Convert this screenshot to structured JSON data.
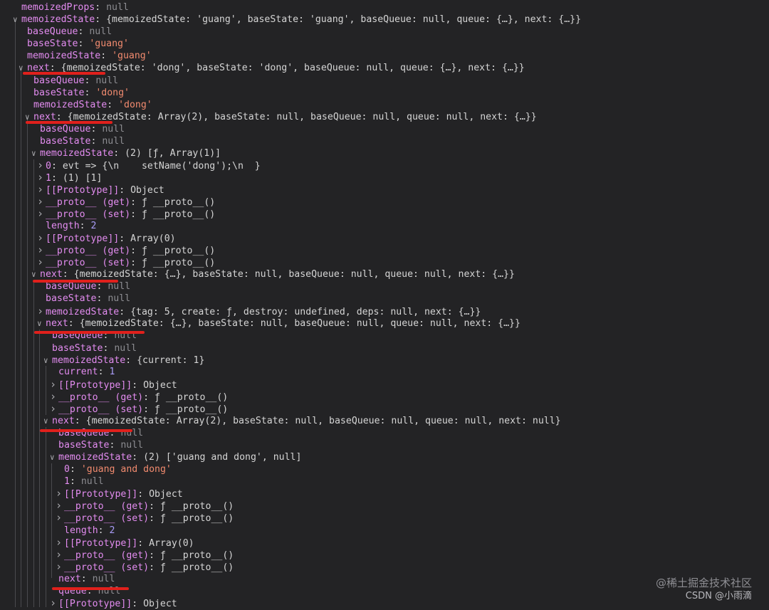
{
  "rows": [
    {
      "key": "memoizedProps",
      "val": "null",
      "t": "null",
      "arrow": ""
    },
    {
      "key": "memoizedState",
      "val": "{memoizedState: 'guang', baseState: 'guang', baseQueue: null, queue: {…}, next: {…}}",
      "t": "preview",
      "arrow": "down"
    },
    {
      "key": "baseQueue",
      "val": "null",
      "t": "null",
      "arrow": ""
    },
    {
      "key": "baseState",
      "val": "'guang'",
      "t": "string",
      "arrow": ""
    },
    {
      "key": "memoizedState",
      "val": "'guang'",
      "t": "string",
      "arrow": ""
    },
    {
      "key": "next",
      "val": "{memoizedState: 'dong', baseState: 'dong', baseQueue: null, queue: {…}, next: {…}}",
      "t": "preview",
      "arrow": "down"
    },
    {
      "key": "baseQueue",
      "val": "null",
      "t": "null",
      "arrow": ""
    },
    {
      "key": "baseState",
      "val": "'dong'",
      "t": "string",
      "arrow": ""
    },
    {
      "key": "memoizedState",
      "val": "'dong'",
      "t": "string",
      "arrow": ""
    },
    {
      "key": "next",
      "val": "{memoizedState: Array(2), baseState: null, baseQueue: null, queue: null, next: {…}}",
      "t": "preview",
      "arrow": "down"
    },
    {
      "key": "baseQueue",
      "val": "null",
      "t": "null",
      "arrow": ""
    },
    {
      "key": "baseState",
      "val": "null",
      "t": "null",
      "arrow": ""
    },
    {
      "key": "memoizedState",
      "val": "(2) [ƒ, Array(1)]",
      "t": "preview",
      "arrow": "down"
    },
    {
      "key": "0",
      "val": "evt => {\\n    setName('dong');\\n  }",
      "t": "func",
      "arrow": "right"
    },
    {
      "key": "1",
      "val": "(1) [1]",
      "t": "preview",
      "arrow": "right"
    },
    {
      "key": "[[Prototype]]",
      "val": "Object",
      "t": "preview",
      "arrow": "right"
    },
    {
      "key": "__proto__ (get)",
      "val": "ƒ __proto__()",
      "t": "func",
      "arrow": "right"
    },
    {
      "key": "__proto__ (set)",
      "val": "ƒ __proto__()",
      "t": "func",
      "arrow": "right"
    },
    {
      "key": "length",
      "val": "2",
      "t": "number",
      "arrow": ""
    },
    {
      "key": "[[Prototype]]",
      "val": "Array(0)",
      "t": "preview",
      "arrow": "right"
    },
    {
      "key": "__proto__ (get)",
      "val": "ƒ __proto__()",
      "t": "func",
      "arrow": "right"
    },
    {
      "key": "__proto__ (set)",
      "val": "ƒ __proto__()",
      "t": "func",
      "arrow": "right"
    },
    {
      "key": "next",
      "val": "{memoizedState: {…}, baseState: null, baseQueue: null, queue: null, next: {…}}",
      "t": "preview",
      "arrow": "down"
    },
    {
      "key": "baseQueue",
      "val": "null",
      "t": "null",
      "arrow": ""
    },
    {
      "key": "baseState",
      "val": "null",
      "t": "null",
      "arrow": ""
    },
    {
      "key": "memoizedState",
      "val": "{tag: 5, create: ƒ, destroy: undefined, deps: null, next: {…}}",
      "t": "preview",
      "arrow": "right"
    },
    {
      "key": "next",
      "val": "{memoizedState: {…}, baseState: null, baseQueue: null, queue: null, next: {…}}",
      "t": "preview",
      "arrow": "down"
    },
    {
      "key": "baseQueue",
      "val": "null",
      "t": "null",
      "arrow": ""
    },
    {
      "key": "baseState",
      "val": "null",
      "t": "null",
      "arrow": ""
    },
    {
      "key": "memoizedState",
      "val": "{current: 1}",
      "t": "preview",
      "arrow": "down"
    },
    {
      "key": "current",
      "val": "1",
      "t": "number",
      "arrow": ""
    },
    {
      "key": "[[Prototype]]",
      "val": "Object",
      "t": "preview",
      "arrow": "right"
    },
    {
      "key": "__proto__ (get)",
      "val": "ƒ __proto__()",
      "t": "func",
      "arrow": "right"
    },
    {
      "key": "__proto__ (set)",
      "val": "ƒ __proto__()",
      "t": "func",
      "arrow": "right"
    },
    {
      "key": "next",
      "val": "{memoizedState: Array(2), baseState: null, baseQueue: null, queue: null, next: null}",
      "t": "preview",
      "arrow": "down"
    },
    {
      "key": "baseQueue",
      "val": "null",
      "t": "null",
      "arrow": ""
    },
    {
      "key": "baseState",
      "val": "null",
      "t": "null",
      "arrow": ""
    },
    {
      "key": "memoizedState",
      "val": "(2) ['guang and dong', null]",
      "t": "preview",
      "arrow": "down"
    },
    {
      "key": "0",
      "val": "'guang and dong'",
      "t": "string",
      "arrow": ""
    },
    {
      "key": "1",
      "val": "null",
      "t": "null",
      "arrow": ""
    },
    {
      "key": "[[Prototype]]",
      "val": "Object",
      "t": "preview",
      "arrow": "right"
    },
    {
      "key": "__proto__ (get)",
      "val": "ƒ __proto__()",
      "t": "func",
      "arrow": "right"
    },
    {
      "key": "__proto__ (set)",
      "val": "ƒ __proto__()",
      "t": "func",
      "arrow": "right"
    },
    {
      "key": "length",
      "val": "2",
      "t": "number",
      "arrow": ""
    },
    {
      "key": "[[Prototype]]",
      "val": "Array(0)",
      "t": "preview",
      "arrow": "right"
    },
    {
      "key": "__proto__ (get)",
      "val": "ƒ __proto__()",
      "t": "func",
      "arrow": "right"
    },
    {
      "key": "__proto__ (set)",
      "val": "ƒ __proto__()",
      "t": "func",
      "arrow": "right"
    },
    {
      "key": "next",
      "val": "null",
      "t": "null",
      "arrow": ""
    },
    {
      "key": "queue",
      "val": "null",
      "t": "null",
      "arrow": ""
    },
    {
      "key": "[[Prototype]]",
      "val": "Object",
      "t": "preview",
      "arrow": "right"
    }
  ],
  "watermark": {
    "line1": "@稀土掘金技术社区",
    "line2": "CSDN @小雨滴"
  },
  "colors": {
    "background": "#232325",
    "key": "#e38cf0",
    "string": "#f28b6f",
    "number": "#a99cf7",
    "null": "#8d8d92",
    "annotation": "#e0201c"
  }
}
